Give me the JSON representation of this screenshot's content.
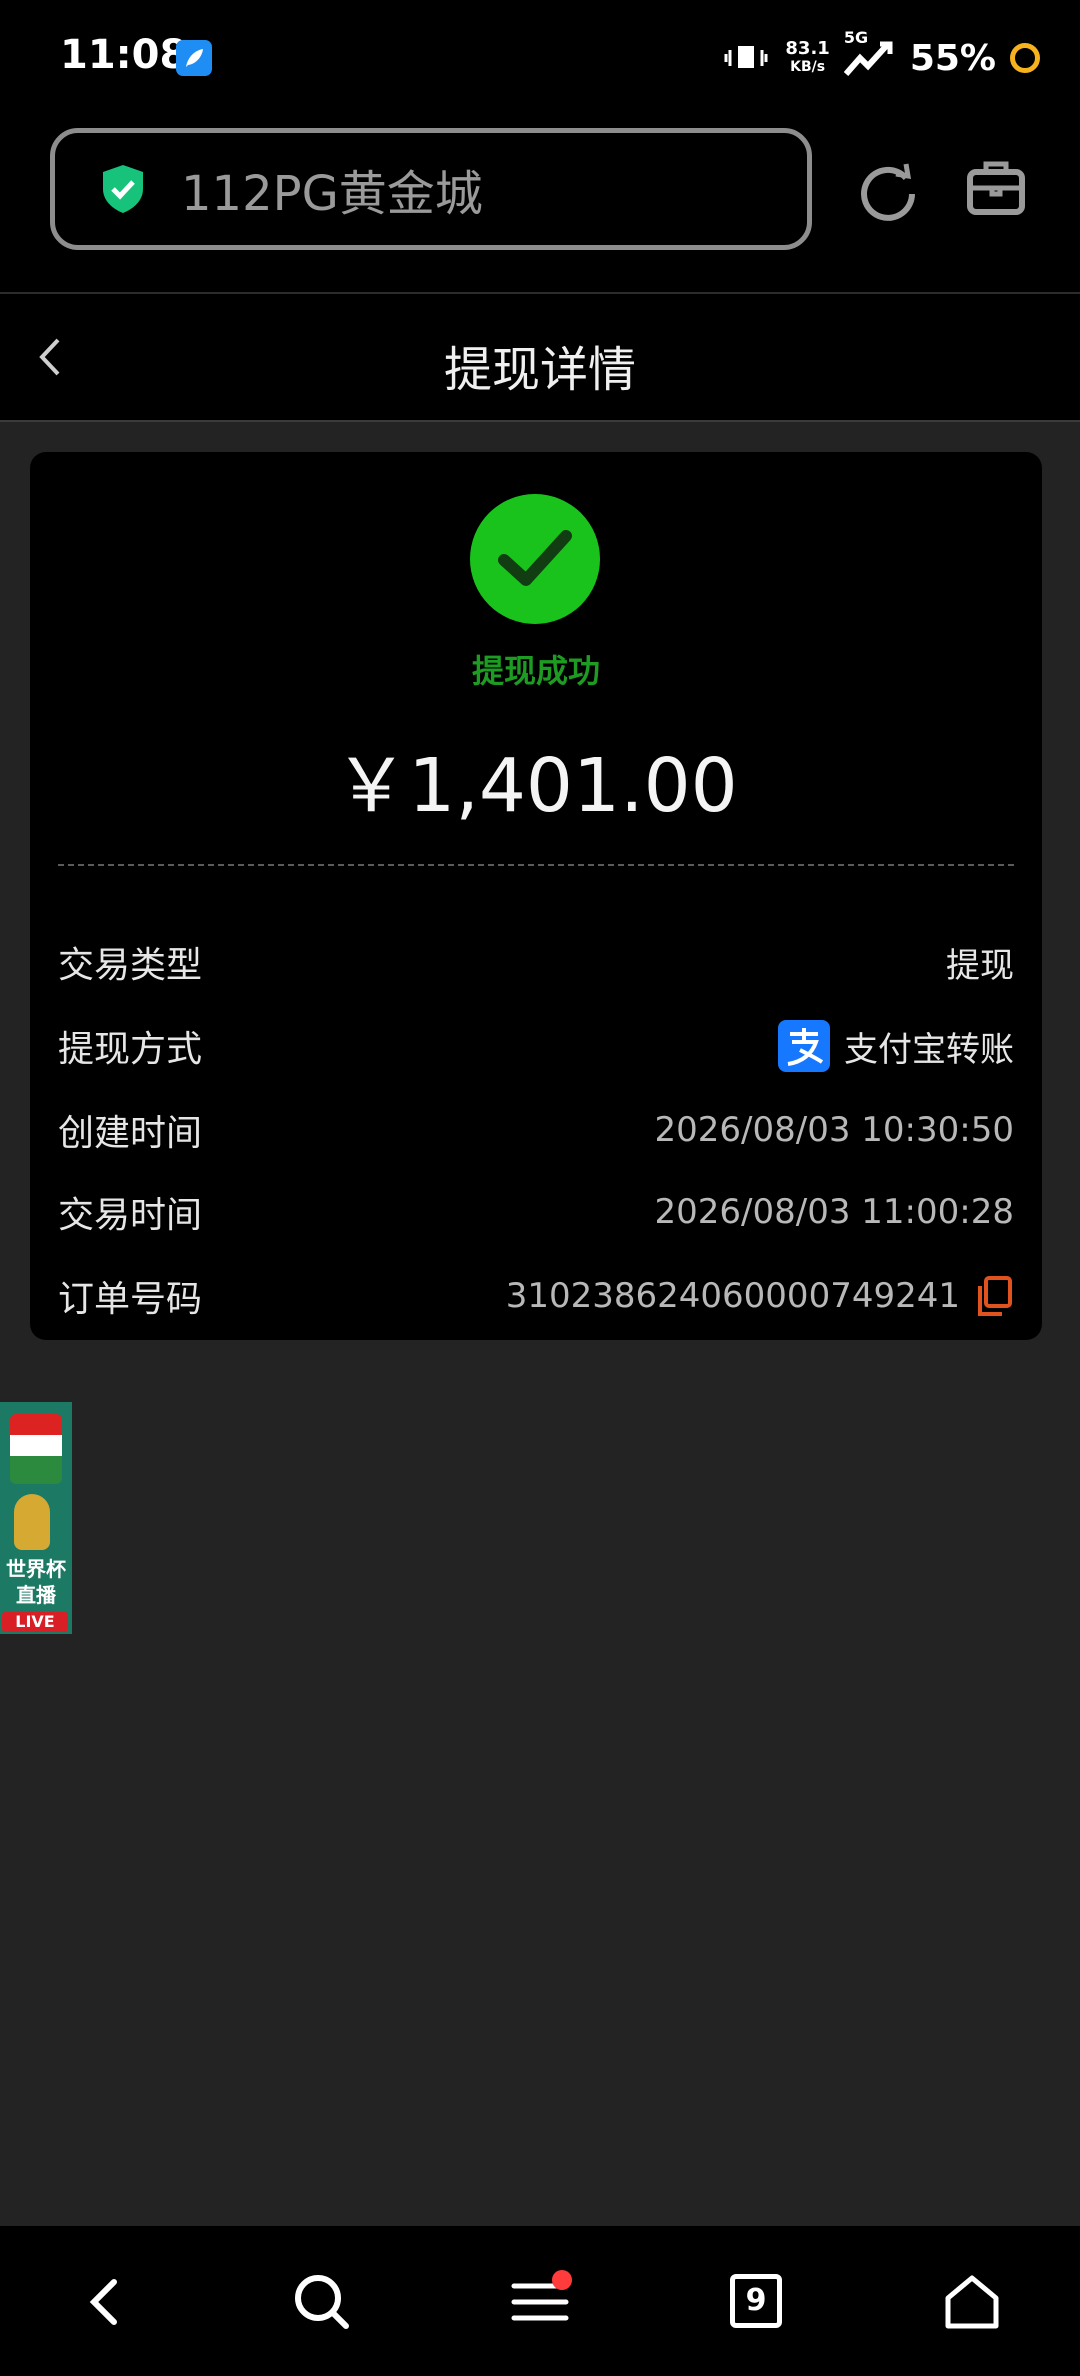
{
  "status_bar": {
    "time": "11:08",
    "net_speed": "83.1",
    "net_unit": "KB/s",
    "network": "5G",
    "battery": "55%",
    "colors": {
      "battery_ring": "#f6b31d",
      "app_badge": "#1e8ef5"
    }
  },
  "browser": {
    "url_title": "112PG黄金城",
    "icons": [
      "shield-check-icon",
      "refresh-icon",
      "toolbox-icon"
    ],
    "colors": {
      "shield": "#17c27a"
    }
  },
  "page": {
    "title": "提现详情"
  },
  "result": {
    "status": "提现成功",
    "amount": "￥1,401.00",
    "colors": {
      "success_green": "#19c31c",
      "status_text": "#1e9b22"
    }
  },
  "details": {
    "rows": [
      {
        "label": "交易类型",
        "value": "提现"
      },
      {
        "label": "提现方式",
        "value": "支付宝转账"
      },
      {
        "label": "创建时间",
        "value": "2026/08/03 10:30:50"
      },
      {
        "label": "交易时间",
        "value": "2026/08/03 11:00:28"
      },
      {
        "label": "订单号码",
        "value": "31023862406000074924​1"
      }
    ]
  },
  "promo": {
    "line1": "世界杯",
    "line2": "直播",
    "tag": "LIVE"
  },
  "bottom_nav": {
    "tab_count": "9",
    "icons": [
      "back-icon",
      "search-icon",
      "menu-icon",
      "tabs-icon",
      "home-icon"
    ]
  }
}
